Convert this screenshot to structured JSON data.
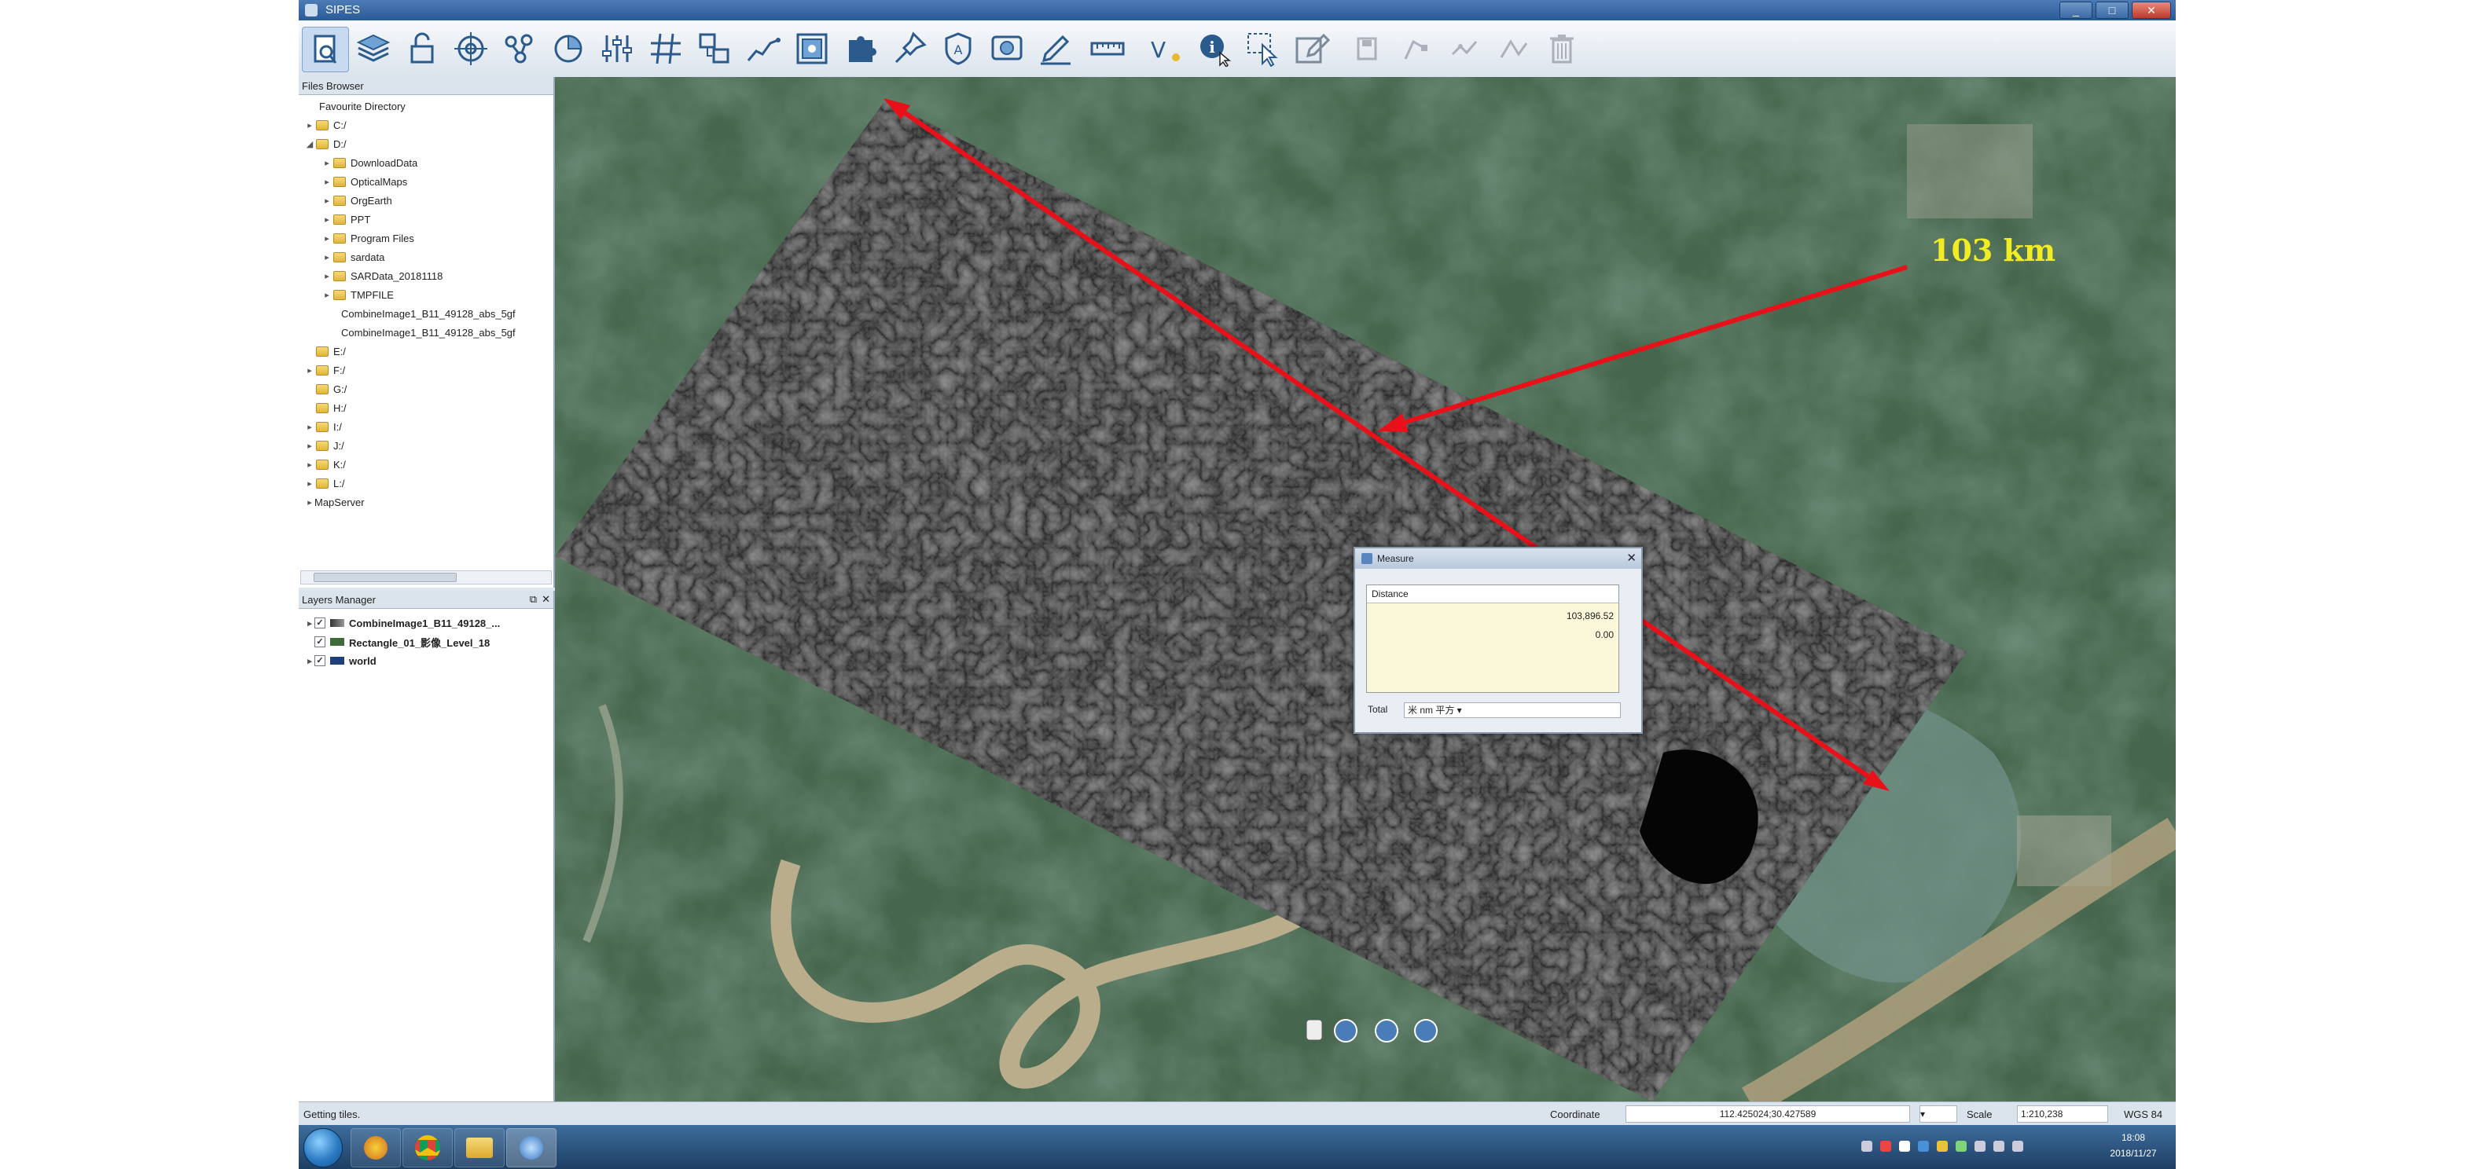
{
  "window": {
    "title": "SIPES"
  },
  "toolbar": {
    "icons": [
      "identify-icon",
      "layers-icon",
      "lock-icon",
      "target-icon",
      "network-icon",
      "pie-icon",
      "sliders-icon",
      "grid-icon",
      "transform-icon",
      "profile-icon",
      "georef-icon",
      "puzzle-icon",
      "pin-icon",
      "shield-icon",
      "digitize-icon",
      "edit-icon",
      "measure-icon",
      "vector-icon",
      "info-icon",
      "select-icon",
      "pencil-icon",
      "save-icon",
      "node-icon",
      "split-icon",
      "delete-icon"
    ]
  },
  "file_browser": {
    "title": "Files Browser",
    "root": "Favourite Directory",
    "items": [
      "C:/",
      "D:/",
      "DownloadData",
      "OpticalMaps",
      "OrgEarth",
      "PPT",
      "Program Files",
      "sardata",
      "SARData_20181118",
      "TMPFILE",
      "CombineImage1_B11_49128_abs_5gf",
      "CombineImage1_B11_49128_abs_5gf",
      "E:/",
      "F:/",
      "G:/",
      "H:/",
      "I:/",
      "J:/",
      "K:/",
      "L:/",
      "MapServer"
    ]
  },
  "layers_manager": {
    "title": "Layers Manager",
    "layers": [
      "CombineImage1_B11_49128_...",
      "Rectangle_01_影像_Level_18",
      "world"
    ]
  },
  "measure_dialog": {
    "title": "Measure",
    "column": "Distance",
    "values": [
      "103,896.52",
      "0.00"
    ],
    "units_label": "Total",
    "units_value": "米 nm 平方 ▾"
  },
  "annotation": {
    "label": "103 km",
    "color": "#f2ec25",
    "arrow_color": "#e8111a"
  },
  "status": {
    "message": "Getting tiles.",
    "coordinate_label": "Coordinate",
    "coordinate_value": "112.425024;30.427589",
    "scale_label": "Scale",
    "scale_value": "1:210,238",
    "crs": "WGS 84"
  },
  "clock": {
    "time": "18:08",
    "date": "2018/11/27"
  }
}
